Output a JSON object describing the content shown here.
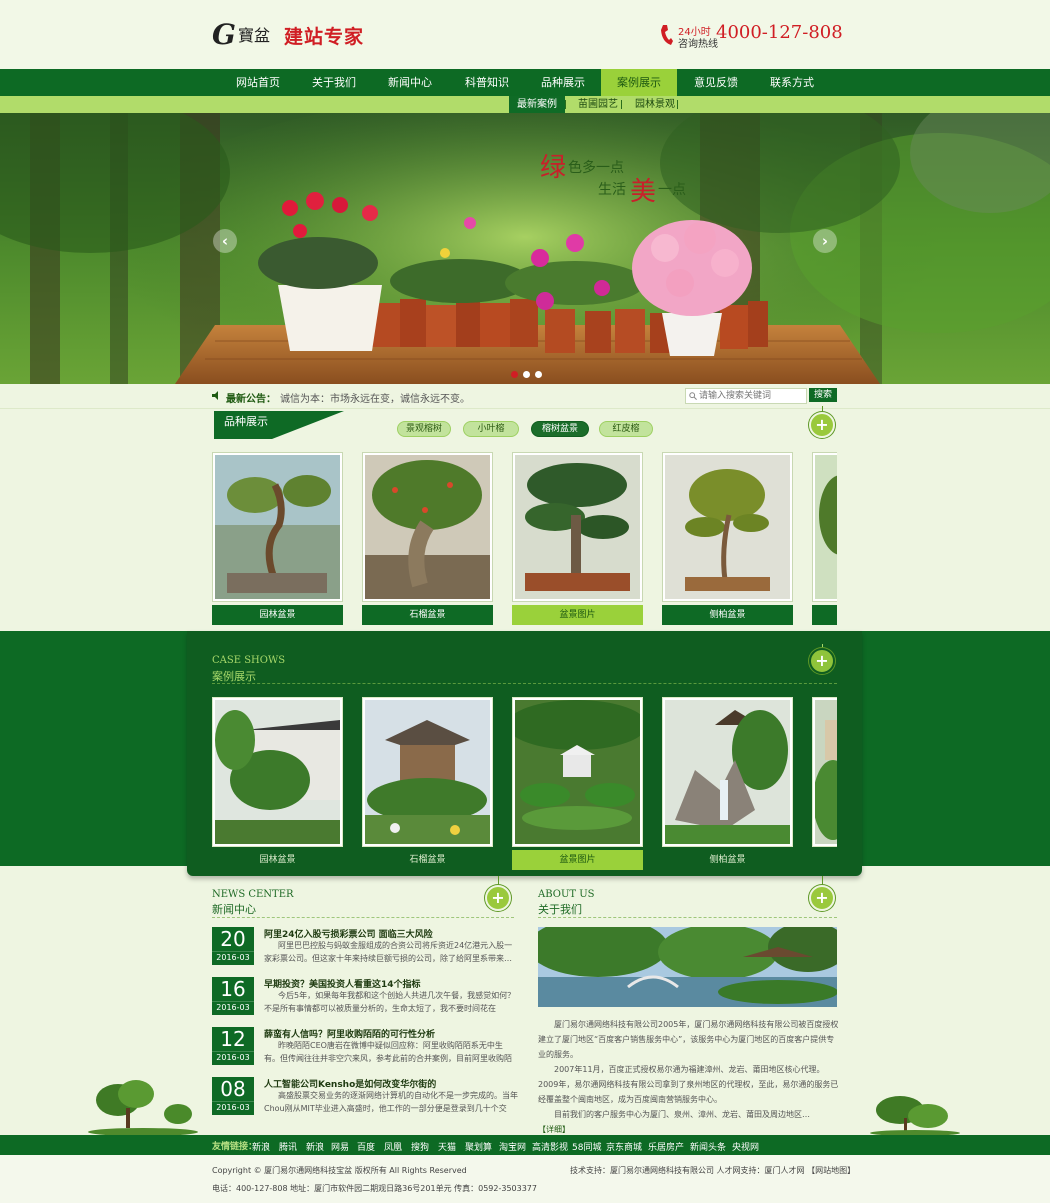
{
  "header": {
    "logo_g": "G",
    "logo_brand": "寶盆",
    "logo_slogan": "建站专家",
    "hotline_24": "24小时",
    "hotline_label": "咨询热线",
    "hotline_number": "4000-127-808"
  },
  "nav": {
    "items": [
      "网站首页",
      "关于我们",
      "新闻中心",
      "科普知识",
      "品种展示",
      "案例展示",
      "意见反馈",
      "联系方式"
    ],
    "active": "案例展示"
  },
  "subnav": {
    "items": [
      "最新案例",
      "苗圃园艺",
      "园林景观"
    ],
    "active": "最新案例"
  },
  "banner": {
    "slogan_line1_big": "绿",
    "slogan_line1": "色多一点",
    "slogan_line2_pre": "生活",
    "slogan_line2_big": "美",
    "slogan_line2_post": "一点",
    "prev": "‹",
    "next": "›"
  },
  "notice": {
    "label": "最新公告：",
    "text": "诚信为本：市场永远在变，诚信永远不变。",
    "search_placeholder": "请输入搜索关键词",
    "search_button": "搜索"
  },
  "varieties": {
    "title": "品种展示",
    "filters": [
      "景观榕树",
      "小叶榕",
      "榕树盆景",
      "红皮榕"
    ],
    "active_filter": "榕树盆景",
    "plus": "+",
    "items": [
      {
        "label": "园林盆景"
      },
      {
        "label": "石榴盆景"
      },
      {
        "label": "盆景图片"
      },
      {
        "label": "侧柏盆景"
      }
    ],
    "active_item": "盆景图片"
  },
  "cases": {
    "title_en": "CASE SHOWS",
    "title_cn": "案例展示",
    "plus": "+",
    "items": [
      {
        "label": "园林盆景"
      },
      {
        "label": "石榴盆景"
      },
      {
        "label": "盆景图片"
      },
      {
        "label": "侧柏盆景"
      }
    ],
    "active_item": "盆景图片"
  },
  "news": {
    "title_en": "NEWS CENTER",
    "title_cn": "新闻中心",
    "plus": "+",
    "items": [
      {
        "day": "20",
        "month": "2016-03",
        "title": "阿里24亿入股亏损彩票公司 面临三大风险",
        "summary": "阿里巴巴控股与蚂蚁金服组成的合资公司将斥资近24亿港元入股一家彩票公司。但这家十年来持续巨额亏损的公司，除了给阿里系带来…"
      },
      {
        "day": "16",
        "month": "2016-03",
        "title": "早期投资？美国投资人看重这14个指标",
        "summary": "今后5年，如果每年我都和这个创始人共进几次午餐，我感觉如何？不是所有事情都可以被质量分析的，生命太短了，我不要时间花在与“混…"
      },
      {
        "day": "12",
        "month": "2016-03",
        "title": "薛蛮有人信吗？阿里收购陌陌的可行性分析",
        "summary": "昨晚陌陌CEO唐岩在微博中疑似回应称：阿里收购陌陌系无中生有。但传闻往往并非空穴来风，参考此前的合并案例，目前阿里收购陌陌…"
      },
      {
        "day": "08",
        "month": "2016-03",
        "title": "人工智能公司Kensho是如何改变华尔街的",
        "summary": "高盛股票交易业务的逐渐网络计算机的自动化不是一步完成的。当年Chou刚从MIT毕业进入高盛时，他工作的一部分便是登录到几十个交易…"
      }
    ]
  },
  "about": {
    "title_en": "ABOUT US",
    "title_cn": "关于我们",
    "plus": "+",
    "p1": "厦门易尔通网络科技有限公司2005年，厦门易尔通网络科技有限公司被百度授权建立了厦门地区“百度客户销售服务中心”，该服务中心为厦门地区的百度客户提供专业的服务。",
    "p2": "2007年11月，百度正式授权易尔通为福建漳州、龙岩、莆田地区核心代理。2009年，易尔通网络科技有限公司拿到了泉州地区的代理权，至此，易尔通的服务已经覆盖整个闽南地区，成为百度闽南营销服务中心。",
    "p3": "目前我们的客户服务中心为厦门、泉州、漳州、龙岩、莆田及周边地区…",
    "more": "【详细】"
  },
  "friend_links": {
    "title": "友情链接：",
    "items": [
      "新浪",
      "腾讯",
      "新浪",
      "网易",
      "百度",
      "凤凰",
      "搜狗",
      "天猫",
      "聚划算",
      "淘宝网",
      "高清影视",
      "58同城",
      "京东商城",
      "乐居房产",
      "新闻头条",
      "央视网"
    ]
  },
  "footer": {
    "copyright": "Copyright © 厦门易尔通网络科技宝盆 版权所有 All Rights Reserved",
    "contact": "电话：400-127-808 地址：厦门市软件园二期观日路36号201单元 传真：0592-3503377",
    "support": "技术支持：厦门易尔通网络科技有限公司 人才网支持：厦门人才网 【网站地图】"
  },
  "colors": {
    "primary_green": "#0d6a24",
    "light_green": "#9ad13a",
    "accent_red": "#d01e24",
    "page_bg": "#eef5e1"
  }
}
